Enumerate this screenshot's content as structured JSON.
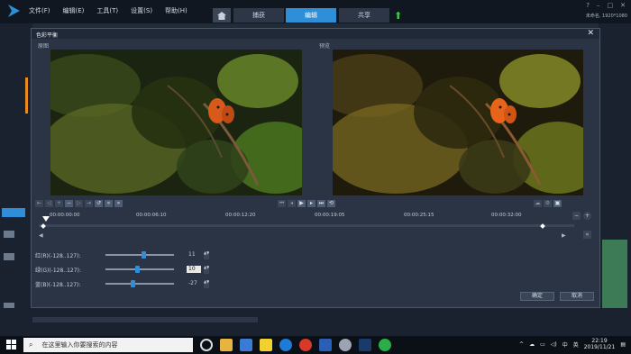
{
  "menubar": {
    "items": [
      "文件(F)",
      "编辑(E)",
      "工具(T)",
      "设置(S)",
      "帮助(H)"
    ],
    "tabs": [
      "捕获",
      "编辑",
      "共享"
    ],
    "active_tab": "编辑",
    "info": "未命名, 1920*1080"
  },
  "dialog": {
    "title": "色彩平衡",
    "original_label": "原图",
    "preview_label": "预览",
    "timecodes": [
      "00:00:00:00",
      "00:00:06:10",
      "00:00:12:20",
      "00:00:19:05",
      "00:00:25:15",
      "00:00:32:00"
    ],
    "sliders": [
      {
        "label": "红(R)(-128..127):",
        "value": "11",
        "fraction": 0.54
      },
      {
        "label": "绿(G)(-128..127):",
        "value": "10",
        "fraction": 0.54,
        "focused": true
      },
      {
        "label": "蓝(B)(-128..127):",
        "value": "-27",
        "fraction": 0.39
      }
    ],
    "ok_label": "确定",
    "cancel_label": "取消"
  },
  "taskbar": {
    "search_placeholder": "在这里输入你要搜索的内容",
    "time": "22:19",
    "date": "2019/11/21",
    "ime": "中",
    "ime2": "英"
  },
  "colors": {
    "accent": "#2e8fd8",
    "dialog_bg": "#2a3445"
  }
}
